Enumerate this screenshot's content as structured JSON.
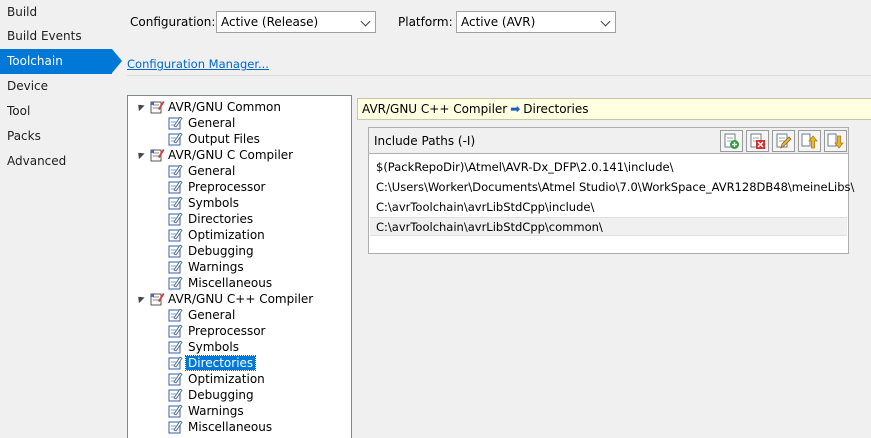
{
  "nav": {
    "items": [
      {
        "label": "Build"
      },
      {
        "label": "Build Events"
      },
      {
        "label": "Toolchain",
        "selected": true
      },
      {
        "label": "Device"
      },
      {
        "label": "Tool"
      },
      {
        "label": "Packs"
      },
      {
        "label": "Advanced"
      }
    ]
  },
  "config": {
    "configuration_label": "Configuration:",
    "configuration_value": "Active (Release)",
    "platform_label": "Platform:",
    "platform_value": "Active (AVR)",
    "manager_link": "Configuration Manager..."
  },
  "tree": {
    "groups": [
      {
        "label": "AVR/GNU Common",
        "children": [
          "General",
          "Output Files"
        ]
      },
      {
        "label": "AVR/GNU C Compiler",
        "children": [
          "General",
          "Preprocessor",
          "Symbols",
          "Directories",
          "Optimization",
          "Debugging",
          "Warnings",
          "Miscellaneous"
        ]
      },
      {
        "label": "AVR/GNU C++ Compiler",
        "children": [
          "General",
          "Preprocessor",
          "Symbols",
          "Directories",
          "Optimization",
          "Debugging",
          "Warnings",
          "Miscellaneous"
        ],
        "selected_child": "Directories"
      }
    ]
  },
  "breadcrumb": {
    "section": "AVR/GNU C++ Compiler",
    "page": "Directories"
  },
  "include_paths": {
    "title": "Include Paths (-I)",
    "toolbar": [
      {
        "name": "add-item",
        "icon": "add-icon"
      },
      {
        "name": "delete-item",
        "icon": "delete-icon"
      },
      {
        "name": "edit-item",
        "icon": "edit-icon"
      },
      {
        "name": "move-up",
        "icon": "arrow-up-icon"
      },
      {
        "name": "move-down",
        "icon": "arrow-down-icon"
      }
    ],
    "paths": [
      "$(PackRepoDir)\\Atmel\\AVR-Dx_DFP\\2.0.141\\include\\",
      "C:\\Users\\Worker\\Documents\\Atmel Studio\\7.0\\WorkSpace_AVR128DB48\\meineLibs\\",
      "C:\\avrToolchain\\avrLibStdCpp\\include\\",
      "C:\\avrToolchain\\avrLibStdCpp\\common\\"
    ],
    "selected_index": 3
  },
  "colors": {
    "accent": "#0078d7",
    "breadcrumb_bg": "#ffffe1",
    "link": "#0066cc"
  }
}
